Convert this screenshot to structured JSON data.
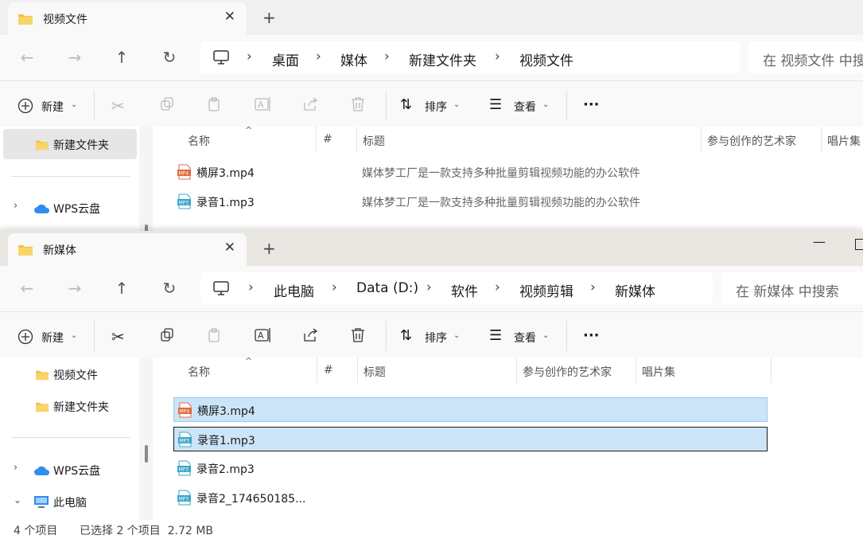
{
  "back_window": {
    "tab_title": "视频文件",
    "breadcrumbs": [
      "桌面",
      "媒体",
      "新建文件夹",
      "视频文件"
    ],
    "search_placeholder": "在 视频文件 中搜",
    "toolbar": {
      "new": "新建",
      "sort": "排序",
      "view": "查看"
    },
    "sidebar": [
      {
        "label": "新建文件夹",
        "icon": "folder-icon",
        "selected": true
      },
      {
        "label": "WPS云盘",
        "icon": "cloud-icon",
        "expandable": true
      }
    ],
    "columns": [
      "名称",
      "#",
      "标题",
      "参与创作的艺术家",
      "唱片集"
    ],
    "files": [
      {
        "name": "横屏3.mp4",
        "title": "媒体梦工厂是一款支持多种批量剪辑视频功能的办公软件",
        "icon": "mp4-file-icon"
      },
      {
        "name": "录音1.mp3",
        "title": "媒体梦工厂是一款支持多种批量剪辑视频功能的办公软件",
        "icon": "mp3-file-icon"
      }
    ]
  },
  "front_window": {
    "tab_title": "新媒体",
    "breadcrumbs": [
      "此电脑",
      "Data (D:)",
      "软件",
      "视频剪辑",
      "新媒体"
    ],
    "search_placeholder": "在 新媒体 中搜索",
    "toolbar": {
      "new": "新建",
      "sort": "排序",
      "view": "查看"
    },
    "sidebar": [
      {
        "label": "视频文件",
        "icon": "folder-icon"
      },
      {
        "label": "新建文件夹",
        "icon": "folder-icon"
      },
      {
        "label": "WPS云盘",
        "icon": "cloud-icon",
        "expandable": true
      },
      {
        "label": "此电脑",
        "icon": "computer-icon",
        "expanded": true
      }
    ],
    "columns": [
      "名称",
      "#",
      "标题",
      "参与创作的艺术家",
      "唱片集"
    ],
    "files": [
      {
        "name": "横屏3.mp4",
        "icon": "mp4-file-icon",
        "selected": true
      },
      {
        "name": "录音1.mp3",
        "icon": "mp3-file-icon",
        "selected": true,
        "focused": true
      },
      {
        "name": "录音2.mp3",
        "icon": "mp3-file-icon"
      },
      {
        "name": "录音2_174650185...",
        "icon": "mp3-file-icon"
      }
    ],
    "status": {
      "count": "4 个项目",
      "selection": "已选择 2 个项目  2.72 MB"
    }
  },
  "colors": {
    "selection_bg": "#cce4f7",
    "selection_border": "#99c9ef",
    "folder": "#f3c23f",
    "accent": "#0067c0"
  }
}
